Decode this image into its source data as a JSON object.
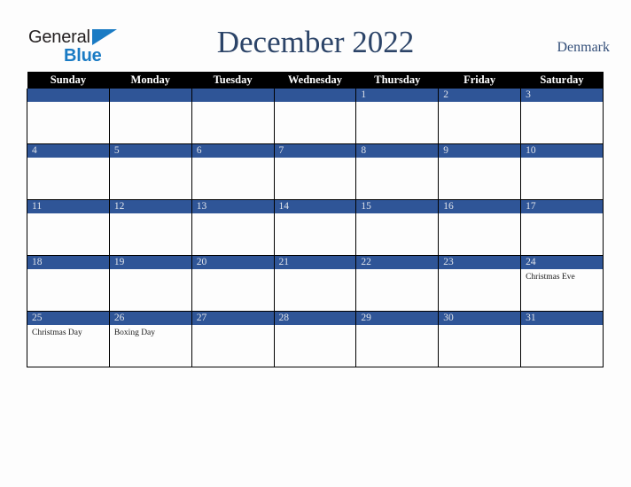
{
  "brand": {
    "name_part1": "General",
    "name_part2": "Blue",
    "triangle_icon": "triangle-icon",
    "color_dark": "#231f20",
    "color_blue": "#1a7bc4"
  },
  "header": {
    "title": "December 2022",
    "country": "Denmark",
    "title_color": "#2c4468"
  },
  "calendar": {
    "weekday_headers": [
      "Sunday",
      "Monday",
      "Tuesday",
      "Wednesday",
      "Thursday",
      "Friday",
      "Saturday"
    ],
    "header_bg": "#000000",
    "header_fg": "#ffffff",
    "day_bar_bg": "#2f5597",
    "day_bar_fg": "#dfe3ea",
    "cell_bg": "#fdfdfd",
    "grid_line": "#000000",
    "weeks": [
      [
        {
          "date": "",
          "events": []
        },
        {
          "date": "",
          "events": []
        },
        {
          "date": "",
          "events": []
        },
        {
          "date": "",
          "events": []
        },
        {
          "date": "1",
          "events": []
        },
        {
          "date": "2",
          "events": []
        },
        {
          "date": "3",
          "events": []
        }
      ],
      [
        {
          "date": "4",
          "events": []
        },
        {
          "date": "5",
          "events": []
        },
        {
          "date": "6",
          "events": []
        },
        {
          "date": "7",
          "events": []
        },
        {
          "date": "8",
          "events": []
        },
        {
          "date": "9",
          "events": []
        },
        {
          "date": "10",
          "events": []
        }
      ],
      [
        {
          "date": "11",
          "events": []
        },
        {
          "date": "12",
          "events": []
        },
        {
          "date": "13",
          "events": []
        },
        {
          "date": "14",
          "events": []
        },
        {
          "date": "15",
          "events": []
        },
        {
          "date": "16",
          "events": []
        },
        {
          "date": "17",
          "events": []
        }
      ],
      [
        {
          "date": "18",
          "events": []
        },
        {
          "date": "19",
          "events": []
        },
        {
          "date": "20",
          "events": []
        },
        {
          "date": "21",
          "events": []
        },
        {
          "date": "22",
          "events": []
        },
        {
          "date": "23",
          "events": []
        },
        {
          "date": "24",
          "events": [
            "Christmas Eve"
          ]
        }
      ],
      [
        {
          "date": "25",
          "events": [
            "Christmas Day"
          ]
        },
        {
          "date": "26",
          "events": [
            "Boxing Day"
          ]
        },
        {
          "date": "27",
          "events": []
        },
        {
          "date": "28",
          "events": []
        },
        {
          "date": "29",
          "events": []
        },
        {
          "date": "30",
          "events": []
        },
        {
          "date": "31",
          "events": []
        }
      ]
    ]
  }
}
